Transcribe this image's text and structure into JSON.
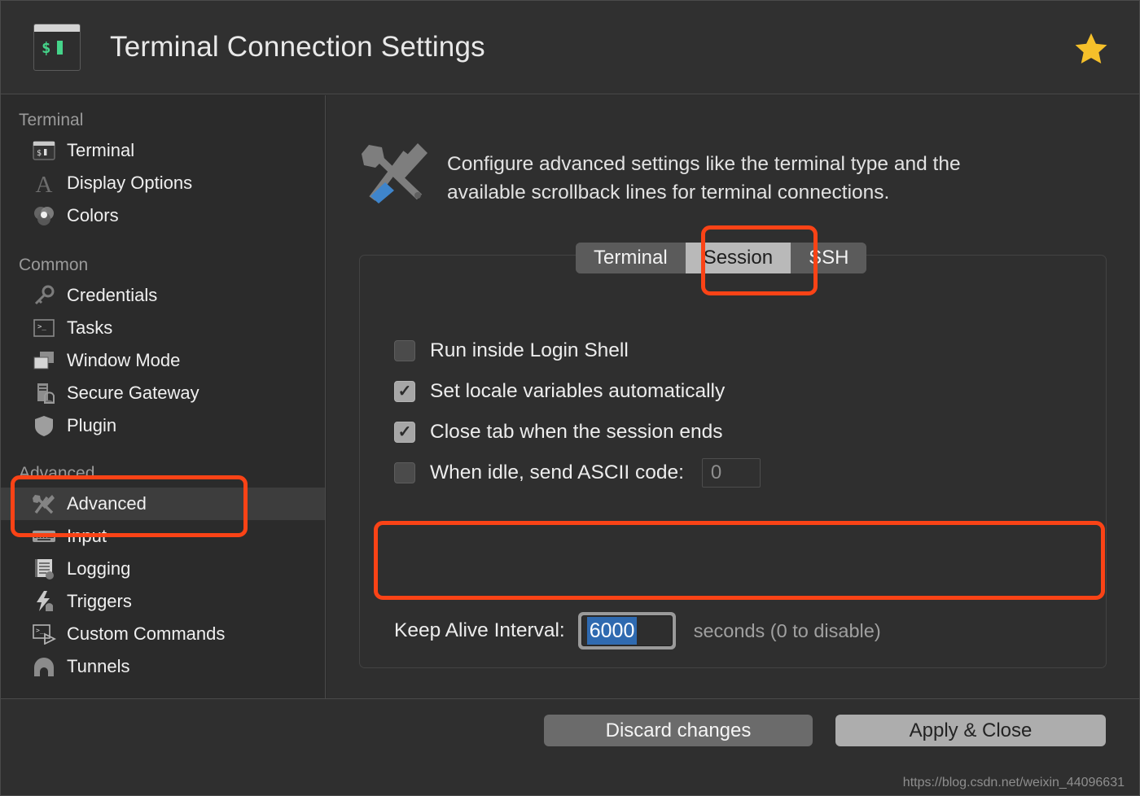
{
  "window": {
    "title": "Terminal Connection Settings",
    "app_icon": "terminal-icon",
    "favorite_icon": "star-icon",
    "accent_color": "#fa4316",
    "selection_color": "#2f6ab0",
    "prompt_glyph": "$"
  },
  "sidebar": {
    "groups": [
      {
        "title": "Terminal",
        "items": [
          {
            "label": "Terminal",
            "icon": "terminal-icon",
            "selected": false
          },
          {
            "label": "Display Options",
            "icon": "font-a-icon",
            "selected": false
          },
          {
            "label": "Colors",
            "icon": "color-circles-icon",
            "selected": false
          }
        ]
      },
      {
        "title": "Common",
        "items": [
          {
            "label": "Credentials",
            "icon": "key-icon",
            "selected": false
          },
          {
            "label": "Tasks",
            "icon": "console-icon",
            "selected": false
          },
          {
            "label": "Window Mode",
            "icon": "windows-icon",
            "selected": false
          },
          {
            "label": "Secure Gateway",
            "icon": "server-shield-icon",
            "selected": false
          },
          {
            "label": "Plugin",
            "icon": "shield-icon",
            "selected": false
          }
        ]
      },
      {
        "title": "Advanced",
        "items": [
          {
            "label": "Advanced",
            "icon": "tools-icon",
            "selected": true
          },
          {
            "label": "Input",
            "icon": "keyboard-icon",
            "selected": false
          },
          {
            "label": "Logging",
            "icon": "notebook-icon",
            "selected": false
          },
          {
            "label": "Triggers",
            "icon": "lightning-icon",
            "selected": false
          },
          {
            "label": "Custom Commands",
            "icon": "console-play-icon",
            "selected": false
          },
          {
            "label": "Tunnels",
            "icon": "tunnel-icon",
            "selected": false
          }
        ]
      }
    ]
  },
  "main": {
    "description": "Configure advanced settings like the terminal type and the available scrollback lines for terminal connections.",
    "description_icon": "tools-icon",
    "tabs": [
      {
        "label": "Terminal",
        "active": false
      },
      {
        "label": "Session",
        "active": true
      },
      {
        "label": "SSH",
        "active": false
      }
    ],
    "options": [
      {
        "label": "Run inside Login Shell",
        "checked": false
      },
      {
        "label": "Set locale variables automatically",
        "checked": true
      },
      {
        "label": "Close tab when the session ends",
        "checked": true
      },
      {
        "label": "When idle, send ASCII code:",
        "checked": false,
        "value": "0"
      }
    ],
    "keep_alive": {
      "label": "Keep Alive Interval:",
      "value": "6000",
      "suffix": "seconds (0 to disable)",
      "selected": true
    }
  },
  "footer": {
    "discard_label": "Discard changes",
    "apply_label": "Apply & Close",
    "watermark": "https://blog.csdn.net/weixin_44096631"
  }
}
